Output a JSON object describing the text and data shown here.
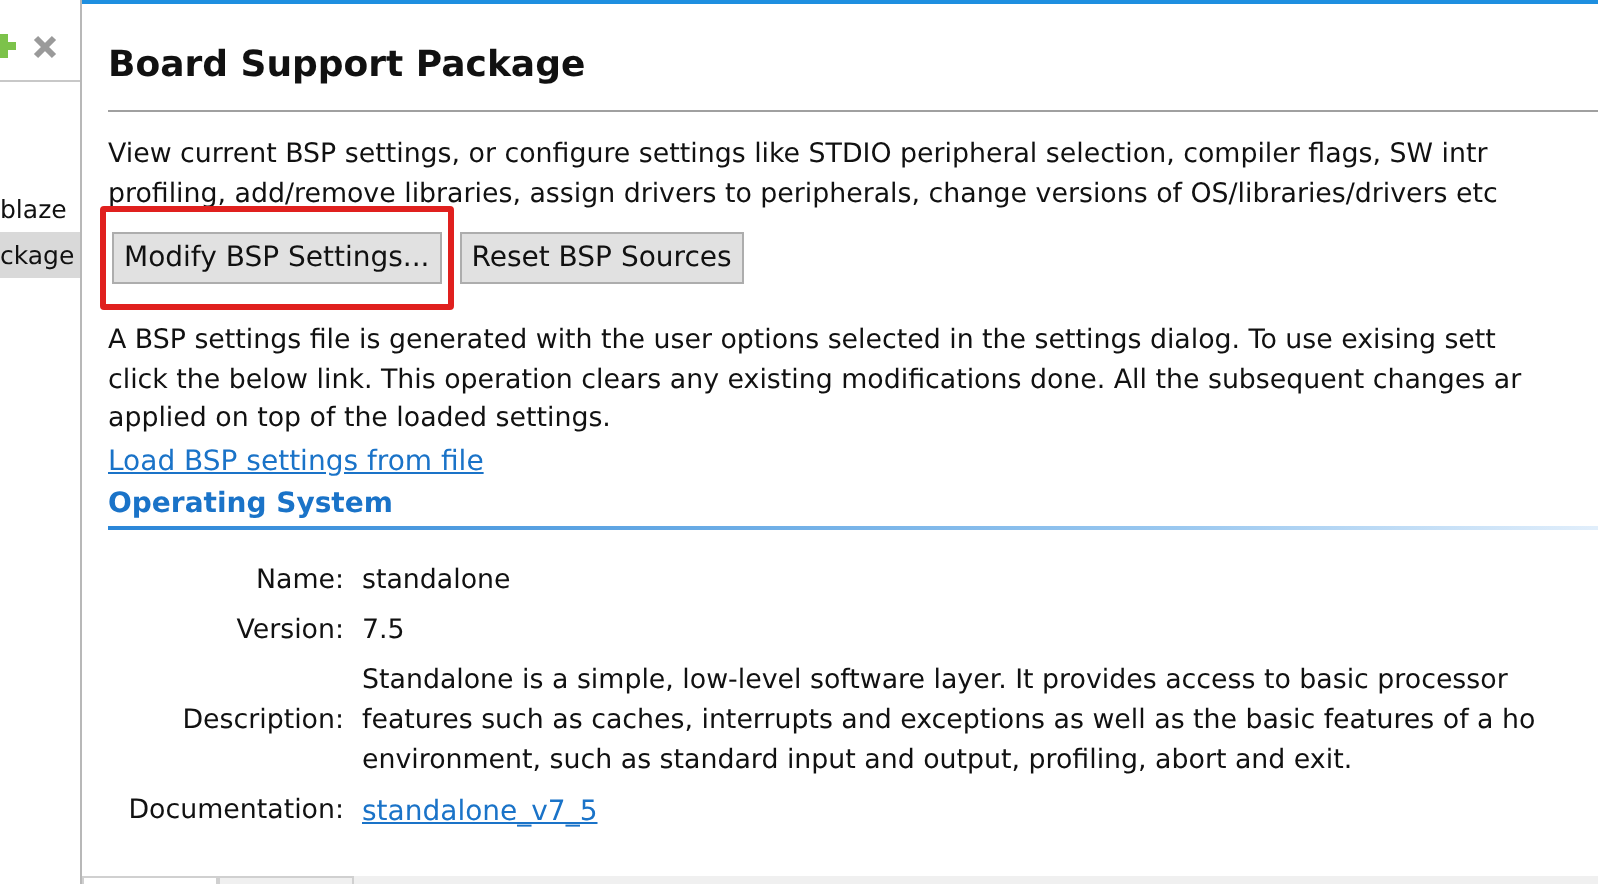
{
  "sidebar": {
    "items": [
      {
        "label": "blaze",
        "selected": false
      },
      {
        "label": "ckage",
        "selected": true
      }
    ]
  },
  "page": {
    "title": "Board Support Package",
    "intro_lines": [
      "View current BSP settings, or configure settings like STDIO peripheral selection, compiler flags, SW intr",
      "profiling, add/remove libraries, assign drivers to peripherals, change versions of OS/libraries/drivers etc"
    ],
    "buttons": [
      {
        "label": "Modify BSP Settings...",
        "highlighted": true
      },
      {
        "label": "Reset BSP Sources",
        "highlighted": false
      }
    ],
    "info_lines": [
      "A BSP settings file is generated with the user options selected in the settings dialog. To use exising sett",
      "click the below link. This operation clears any existing modifications done. All the subsequent changes ar",
      "applied on top of the loaded settings."
    ],
    "load_link": "Load BSP settings from file"
  },
  "operating_system": {
    "heading": "Operating System",
    "fields": [
      {
        "label": "Name:",
        "kind": "text",
        "lines": [
          "standalone"
        ]
      },
      {
        "label": "Version:",
        "kind": "text",
        "lines": [
          "7.5"
        ]
      },
      {
        "label": "Description:",
        "kind": "text",
        "lines": [
          "Standalone is a simple, low-level software layer. It provides access to basic processor",
          "features such as caches, interrupts and exceptions as well as the basic features of a ho",
          "environment, such as standard input and output, profiling, abort and exit."
        ]
      },
      {
        "label": "Documentation:",
        "kind": "link",
        "lines": [
          "standalone_v7_5"
        ]
      }
    ]
  }
}
